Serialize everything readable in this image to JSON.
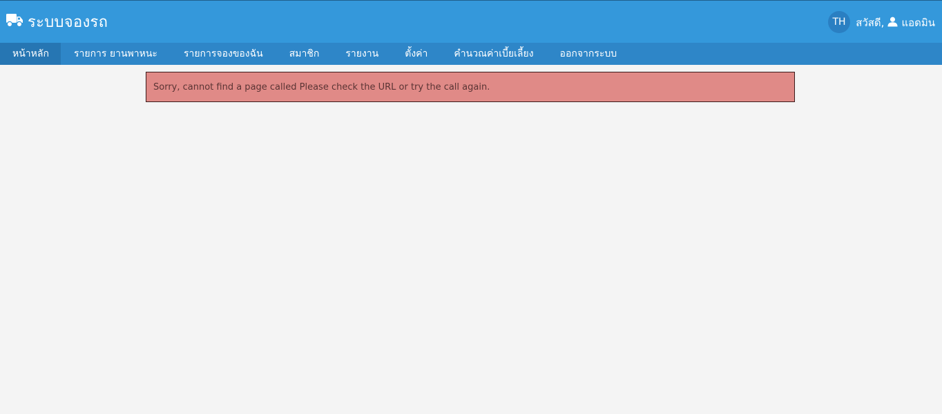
{
  "header": {
    "brand_title": "ระบบจองรถ",
    "brand_icon": "truck-icon",
    "language": "TH",
    "greeting": "สวัสดี,",
    "user_icon": "user-icon",
    "username": "แอดมิน"
  },
  "nav": {
    "items": [
      {
        "label": "หน้าหลัก",
        "active": true
      },
      {
        "label": "รายการ ยานพาหนะ"
      },
      {
        "label": "รายการจองของฉัน"
      },
      {
        "label": "สมาชิก"
      },
      {
        "label": "รายงาน"
      },
      {
        "label": "ตั้งค่า"
      },
      {
        "label": "คำนวณค่าเบี้ยเลี้ยง"
      },
      {
        "label": "ออกจากระบบ"
      }
    ]
  },
  "alert": {
    "message": "Sorry, cannot find a page called Please check the URL or try the call again."
  },
  "colors": {
    "header_bg": "#3498db",
    "nav_bg": "#2e86c8",
    "nav_active_bg": "#2676b3",
    "alert_bg": "#e08a87",
    "page_bg": "#f4f4f4"
  }
}
